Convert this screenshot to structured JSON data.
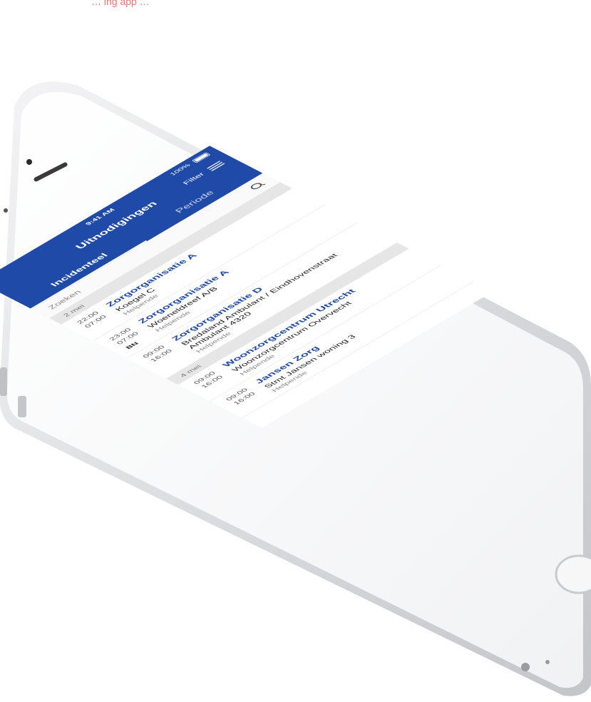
{
  "top_caption": "… ing app …",
  "status": {
    "time": "9:41 AM",
    "battery": "100%"
  },
  "header": {
    "title": "Uitnodigingen",
    "filter_label": "Filter"
  },
  "tabs": [
    {
      "label": "Incidenteel"
    },
    {
      "label": "Periode"
    }
  ],
  "search": {
    "placeholder": "Zoeken"
  },
  "groups": [
    {
      "date": "2 mei",
      "items": [
        {
          "start": "22:00",
          "end": "07:00",
          "org": "Zorgorganisatie A",
          "location": "Koegel C",
          "role": "Helpende"
        },
        {
          "start": "23:00",
          "end": "07:00",
          "org": "Zorgorganisatie A",
          "location": "Woeneldreef A/B",
          "role": "Helpende",
          "badge": "BN"
        },
        {
          "start": "09:00",
          "end": "16:00",
          "org": "Zorgorganisatie D",
          "location": "Bredaland Ambulant / Eindhovenstraat Ambulant 4320",
          "role": "Helpende"
        }
      ]
    },
    {
      "date": "4 mei",
      "items": [
        {
          "start": "09:00",
          "end": "16:00",
          "org": "Woonzorgcentrum Utrecht",
          "location": "Woonzorgcentrum Overvecht",
          "role": "Helpende"
        },
        {
          "start": "09:00",
          "end": "16:00",
          "org": "Jansen Zorg",
          "location": "Stmt Jansen woning 3",
          "role": "Helpende"
        }
      ]
    }
  ]
}
